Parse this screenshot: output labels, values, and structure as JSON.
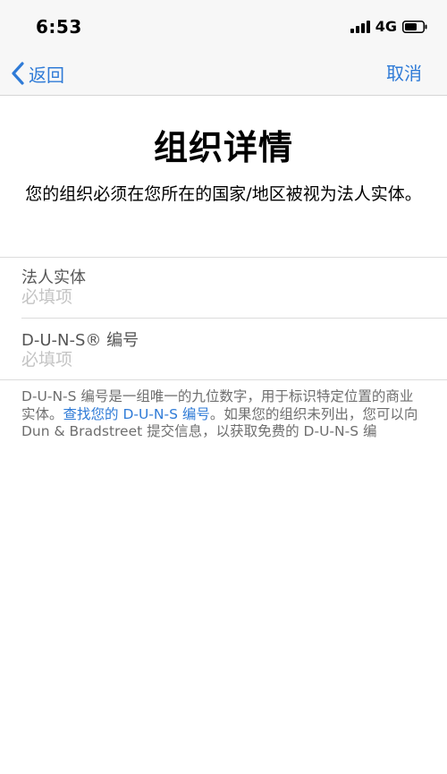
{
  "status_bar": {
    "time": "6:53",
    "network": "4G"
  },
  "nav": {
    "back_label": "返回",
    "cancel_label": "取消"
  },
  "page": {
    "title": "组织详情",
    "subtitle": "您的组织必须在您所在的国家/地区被视为法人实体。"
  },
  "form": {
    "legal_entity": {
      "label": "法人实体",
      "placeholder": "必填项",
      "value": ""
    },
    "duns": {
      "label": "D-U-N-S® 编号",
      "placeholder": "必填项",
      "value": ""
    }
  },
  "footnote": {
    "text_before": "D-U-N-S 编号是一组唯一的九位数字，用于标识特定位置的商业实体。",
    "link": "查找您的 D-U-N-S 编号",
    "text_after": "。如果您的组织未列出，您可以向 Dun & Bradstreet 提交信息，以获取免费的 D-U-N-S 编"
  },
  "colors": {
    "accent": "#2f7bd7",
    "placeholder": "#c4c4c4",
    "bar_background": "#f7f7f7"
  },
  "icons": {
    "back": "chevron-left-icon",
    "signal": "signal-icon",
    "battery": "battery-icon"
  }
}
